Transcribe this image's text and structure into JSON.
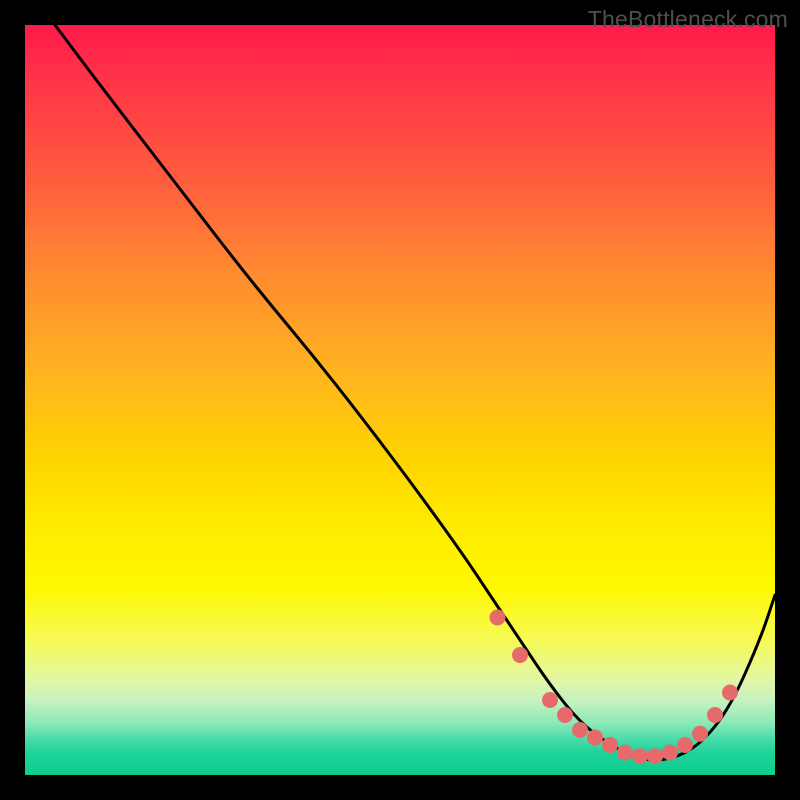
{
  "watermark": "TheBottleneck.com",
  "chart_data": {
    "type": "line",
    "title": "",
    "xlabel": "",
    "ylabel": "",
    "xlim": [
      0,
      100
    ],
    "ylim": [
      0,
      100
    ],
    "series": [
      {
        "name": "bottleneck-curve",
        "x": [
          4,
          10,
          20,
          30,
          40,
          50,
          58,
          62,
          66,
          70,
          74,
          78,
          82,
          86,
          90,
          94,
          98,
          100
        ],
        "y": [
          100,
          92,
          79,
          66,
          54,
          41,
          30,
          24,
          18,
          12,
          7,
          4,
          2,
          2,
          4,
          9,
          18,
          24
        ]
      }
    ],
    "markers": {
      "name": "highlight-dots",
      "x": [
        63,
        66,
        70,
        72,
        74,
        76,
        78,
        80,
        82,
        84,
        86,
        88,
        90,
        92,
        94
      ],
      "y": [
        21,
        16,
        10,
        8,
        6,
        5,
        4,
        3,
        2.5,
        2.5,
        3,
        4,
        5.5,
        8,
        11
      ]
    },
    "gradient_stops": [
      {
        "pos": 0,
        "color": "#ff1a4b"
      },
      {
        "pos": 50,
        "color": "#ffb320"
      },
      {
        "pos": 75,
        "color": "#fef800"
      },
      {
        "pos": 100,
        "color": "#0ccd90"
      }
    ]
  }
}
